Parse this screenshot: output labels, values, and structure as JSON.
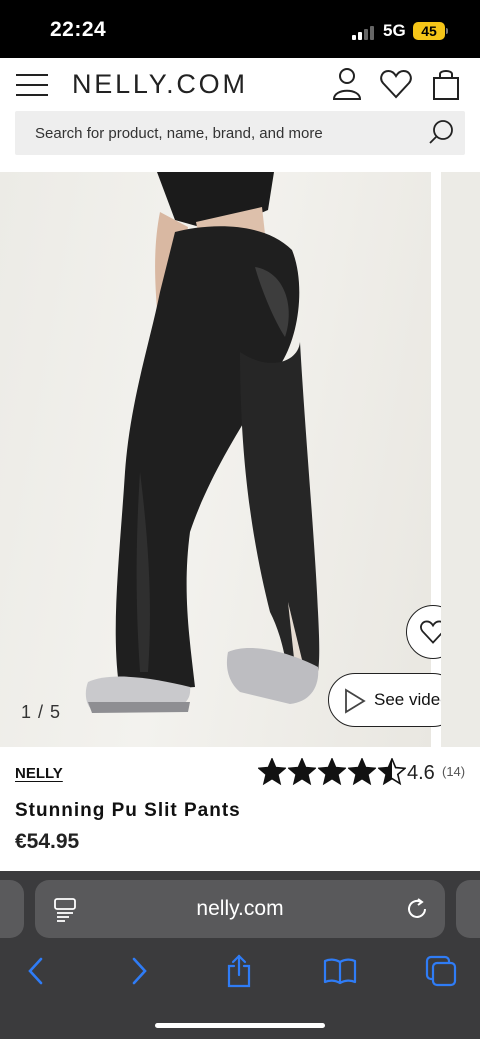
{
  "status_bar": {
    "time": "22:24",
    "network": "5G",
    "battery": "45"
  },
  "header": {
    "logo": "NELLY.COM",
    "icons": [
      "menu-icon",
      "account-icon",
      "heart-icon",
      "bag-icon"
    ],
    "search": {
      "placeholder": "Search for product, name, brand, and more"
    }
  },
  "gallery": {
    "counter": "1 / 5",
    "video_label": "See video"
  },
  "product": {
    "brand": "NELLY",
    "name": "Stunning Pu Slit Pants",
    "price": "€54.95",
    "rating": "4.6",
    "rating_count": "(14)",
    "stars_filled": 4.5,
    "stars_total": 5
  },
  "browser": {
    "url": "nelly.com",
    "icons": [
      "back-icon",
      "forward-icon",
      "share-icon",
      "bookmarks-icon",
      "tabs-icon"
    ]
  },
  "colors": {
    "accent_ios": "#2f7cf6",
    "battery": "#f5c518",
    "stars": "#111111"
  }
}
